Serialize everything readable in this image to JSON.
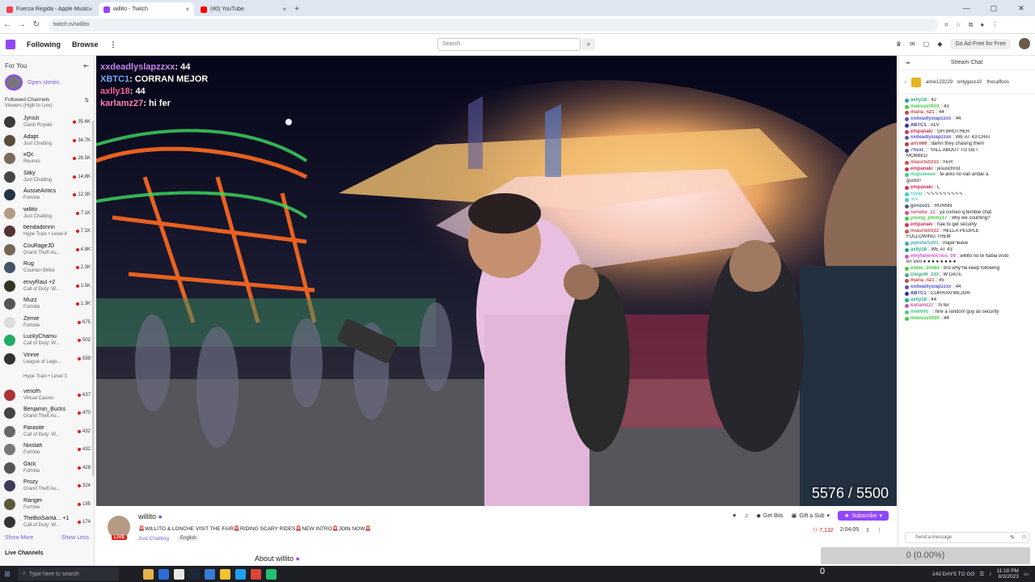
{
  "browser": {
    "tabs": [
      {
        "title": "Fuerza Regida - Apple Music",
        "color": "#fa3c4c",
        "active": false
      },
      {
        "title": "willito - Twitch",
        "color": "#9146ff",
        "active": true
      },
      {
        "title": "(40) YouTube",
        "color": "#ff0000",
        "active": false
      }
    ],
    "url": "twitch.tv/willito"
  },
  "nav": {
    "following": "Following",
    "browse": "Browse",
    "search_placeholder": "Search",
    "ad_free": "Go Ad-Free for Free"
  },
  "sidebar": {
    "for_you": "For You",
    "open_stories": "Open stories",
    "followed_channels": "Followed Channels",
    "sort": "Viewers (High to Low)",
    "channels": [
      {
        "name": "Jynxzi",
        "game": "Clash Royale",
        "viewers": "35.6K",
        "color": "#3a3a3a"
      },
      {
        "name": "Adapt",
        "game": "Just Chatting",
        "viewers": "34.7K",
        "color": "#5a4a3a"
      },
      {
        "name": "xQc",
        "game": "Reunes",
        "viewers": "26.5K",
        "color": "#7a6a5a"
      },
      {
        "name": "Silky",
        "game": "Just Chatting",
        "viewers": "14.8K",
        "color": "#444"
      },
      {
        "name": "AussieAntics",
        "game": "Fortnite",
        "viewers": "12.3K",
        "color": "#234"
      },
      {
        "name": "willito",
        "game": "Just Chatting",
        "viewers": "7.1K",
        "color": "#b59a84"
      },
      {
        "name": "bendadonnn",
        "game": "Hype Train • Level 4",
        "viewers": "7.1K",
        "color": "#533"
      },
      {
        "name": "CouRageJD",
        "game": "Grand Theft Au...",
        "viewers": "4.8K",
        "color": "#765"
      },
      {
        "name": "Rug",
        "game": "Counter-Strike",
        "viewers": "2.3K",
        "color": "#456"
      },
      {
        "name": "envyRaul +2",
        "game": "Call of Duty: W...",
        "viewers": "1.5K",
        "color": "#332"
      },
      {
        "name": "Muzz",
        "game": "Fortnite",
        "viewers": "1.3K",
        "color": "#555"
      },
      {
        "name": "Zemie",
        "game": "Fortnite",
        "viewers": "675",
        "color": "#ddd"
      },
      {
        "name": "LuckyChamu",
        "game": "Call of Duty: W...",
        "viewers": "502",
        "color": "#2a6"
      },
      {
        "name": "Vinnie",
        "game": "League of Lege...",
        "viewers": "599",
        "color": "#333"
      },
      {
        "name": "",
        "game": "Hype Train • Level 3",
        "viewers": "",
        "color": "#fff"
      },
      {
        "name": "venofh",
        "game": "Virtual Casino",
        "viewers": "637",
        "color": "#a33"
      },
      {
        "name": "Benjamin_Bucks",
        "game": "Grand Theft Au...",
        "viewers": "470",
        "color": "#444"
      },
      {
        "name": "Parasite",
        "game": "Call of Duty: W...",
        "viewers": "432",
        "color": "#666"
      },
      {
        "name": "Nixstah",
        "game": "Fortnite",
        "viewers": "432",
        "color": "#777"
      },
      {
        "name": "Glick",
        "game": "Fortnite",
        "viewers": "428",
        "color": "#555"
      },
      {
        "name": "Prozy",
        "game": "Grand Theft Au...",
        "viewers": "324",
        "color": "#3a3a5a"
      },
      {
        "name": "Ranger",
        "game": "Fortnite",
        "viewers": "185",
        "color": "#5a5a3a"
      },
      {
        "name": "TheBoiSanta... +1",
        "game": "Call of Duty: W...",
        "viewers": "174",
        "color": "#333"
      }
    ],
    "show_more": "Show More",
    "show_less": "Show Less",
    "live_channels": "Live Channels"
  },
  "video": {
    "overlay": [
      {
        "user": "xxdeadlyslapzzxx",
        "text": "44",
        "color": "#c586f5"
      },
      {
        "user": "XBTC1",
        "text": "CORRAN MEJOR",
        "color": "#78a8ff"
      },
      {
        "user": "axlly18",
        "text": "44",
        "color": "#ff5fa0"
      },
      {
        "user": "karlamz27",
        "text": "hi fer",
        "color": "#ff7fbf"
      }
    ],
    "goal_text": "5576 / 5500"
  },
  "stream": {
    "channel": "willito",
    "live_label": "LIVE",
    "title": "🚨WILLITO & LONCHE VISIT THE FAIR🚨RIDING SCARY RIDES🚨NEW INTRO🚨JOIN NOW🚨",
    "category": "Just Chatting",
    "tag": "English",
    "get_bits": "Get Bits",
    "gift_sub": "Gift a Sub",
    "subscribe": "Subscribe",
    "viewers": "7,132",
    "uptime": "2:04:05",
    "about": "About willito"
  },
  "chat": {
    "title": "Stream Chat",
    "pinned": [
      "amie123229",
      "onlygass10",
      "thesaffoos"
    ],
    "messages": [
      {
        "user": "axlly18",
        "text": ": 42",
        "color": "#2a8"
      },
      {
        "user": "meesus0939",
        "text": ": 43",
        "color": "#4c4"
      },
      {
        "user": "maria_n21",
        "text": ": 44",
        "color": "#c44"
      },
      {
        "user": "xxdeadlyslapzzxx",
        "text": ": 44",
        "color": "#55c"
      },
      {
        "user": "XBTC1",
        "text": ": ALV",
        "color": "#339"
      },
      {
        "user": "empanaki",
        "text": ": OH BROTHER",
        "color": "#c35"
      },
      {
        "user": "xxdeadlyslapzzxx",
        "text": ": WE AT 43 CHAT",
        "color": "#55c"
      },
      {
        "user": "arrrii66",
        "text": ": damn they chasing them",
        "color": "#a44"
      },
      {
        "user": "7hsst_",
        "text": ": YALL ABOUT TO GET",
        "color": "#55a"
      },
      {
        "user": "",
        "text": "MOBBED",
        "color": "#55a"
      },
      {
        "user": "mlaurte0333",
        "text": ": FER",
        "color": "#c55"
      },
      {
        "user": "empanaki",
        "text": ": jesuschrist",
        "color": "#c35"
      },
      {
        "user": "migueeeee",
        "text": ": te amo no van andar a",
        "color": "#4c8"
      },
      {
        "user": "",
        "text": "gusto!!",
        "color": "#4c8"
      },
      {
        "user": "empanaki",
        "text": ": L",
        "color": "#c35"
      },
      {
        "user": "ruvai",
        "text": ": ∿∿∿∿∿∿∿∿∿",
        "color": "#4cc"
      },
      {
        "user": "∿∿",
        "text": "",
        "color": "#4cc"
      },
      {
        "user": "gonzo21",
        "text": ": RUNNN",
        "color": "#557"
      },
      {
        "user": "neneke_12",
        "text": ": ya comeo q terrible chat",
        "color": "#c58"
      },
      {
        "user": "young_jimmy17",
        "text": ": why we counting?",
        "color": "#4c4"
      },
      {
        "user": "empanaki",
        "text": ": hae to get security",
        "color": "#c35"
      },
      {
        "user": "mlaurte0333",
        "text": ": HELLA PEOPLE",
        "color": "#c55"
      },
      {
        "user": "",
        "text": "FOLLOWING THEM",
        "color": "#c55"
      },
      {
        "user": "jojosfarsz01",
        "text": ": major leave",
        "color": "#4aa"
      },
      {
        "user": "axlly18",
        "text": ": WE AT 43",
        "color": "#2a8"
      },
      {
        "user": "emyfanenocrios_00",
        "text": ": willito no te habia visto",
        "color": "#c5c"
      },
      {
        "user": "",
        "text": "en vivo ● ● ● ● ● ● ● ●",
        "color": "#c5c"
      },
      {
        "user": "eddie_30484",
        "text": ": bro why he keep following",
        "color": "#4c4"
      },
      {
        "user": "DiegoM_333",
        "text": ": W DATE",
        "color": "#4a8"
      },
      {
        "user": "maria_n21",
        "text": ": 45",
        "color": "#c44"
      },
      {
        "user": "xxdeadlyslapzzxx",
        "text": ": 44",
        "color": "#55c"
      },
      {
        "user": "XBTC1",
        "text": ": CORRAN MEJOR",
        "color": "#339"
      },
      {
        "user": "axlly18",
        "text": ": 44",
        "color": "#2a8"
      },
      {
        "user": "karlamz27",
        "text": ": hi fer",
        "color": "#c5a"
      },
      {
        "user": "me6666_",
        "text": ": hire a random guy as security",
        "color": "#4c8"
      },
      {
        "user": "meesus0939",
        "text": ": 44",
        "color": "#4c4"
      }
    ],
    "input_placeholder": "Send a message"
  },
  "progress": {
    "label": "0 (0.00%)",
    "fraction": 0.0
  },
  "taskbar": {
    "search": "Type here to search",
    "counter": "0",
    "tray_text": "143 DAYS TO GO",
    "time": "11:18 PM",
    "date": "8/3/2023"
  },
  "colors": {
    "accent": "#9146ff",
    "live": "#e91916"
  }
}
